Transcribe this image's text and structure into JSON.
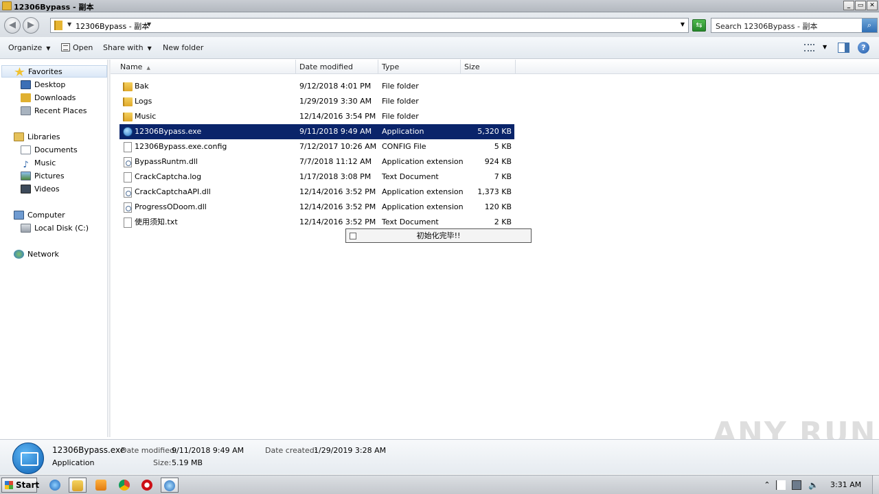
{
  "window": {
    "title": "12306Bypass - 副本",
    "buttons": [
      "_",
      "▭",
      "✕"
    ]
  },
  "address": {
    "path": "12306Bypass - 副本",
    "search_placeholder": "Search 12306Bypass - 副本"
  },
  "toolbar": {
    "organize": "Organize",
    "open": "Open",
    "share_with": "Share with",
    "new_folder": "New folder"
  },
  "nav": {
    "favorites": "Favorites",
    "desktop": "Desktop",
    "downloads": "Downloads",
    "recent_places": "Recent Places",
    "libraries": "Libraries",
    "documents": "Documents",
    "music": "Music",
    "pictures": "Pictures",
    "videos": "Videos",
    "computer": "Computer",
    "local_disk": "Local Disk (C:)",
    "network": "Network"
  },
  "columns": {
    "name": "Name",
    "date_modified": "Date modified",
    "type": "Type",
    "size": "Size"
  },
  "files": [
    {
      "name": "Bak",
      "date": "9/12/2018 4:01 PM",
      "type": "File folder",
      "size": "",
      "icon": "folder-icon"
    },
    {
      "name": "Logs",
      "date": "1/29/2019 3:30 AM",
      "type": "File folder",
      "size": "",
      "icon": "folder-icon"
    },
    {
      "name": "Music",
      "date": "12/14/2016 3:54 PM",
      "type": "File folder",
      "size": "",
      "icon": "folder-icon"
    },
    {
      "name": "12306Bypass.exe",
      "date": "9/11/2018 9:49 AM",
      "type": "Application",
      "size": "5,320 KB",
      "icon": "app-icon",
      "selected": true
    },
    {
      "name": "12306Bypass.exe.config",
      "date": "7/12/2017 10:26 AM",
      "type": "CONFIG File",
      "size": "5 KB",
      "icon": "file-icon"
    },
    {
      "name": "BypassRuntm.dll",
      "date": "7/7/2018 11:12 AM",
      "type": "Application extension",
      "size": "924 KB",
      "icon": "dll-icon"
    },
    {
      "name": "CrackCaptcha.log",
      "date": "1/17/2018 3:08 PM",
      "type": "Text Document",
      "size": "7 KB",
      "icon": "file-icon"
    },
    {
      "name": "CrackCaptchaAPI.dll",
      "date": "12/14/2016 3:52 PM",
      "type": "Application extension",
      "size": "1,373 KB",
      "icon": "dll-icon"
    },
    {
      "name": "ProgressODoom.dll",
      "date": "12/14/2016 3:52 PM",
      "type": "Application extension",
      "size": "120 KB",
      "icon": "dll-icon"
    },
    {
      "name": "使用须知.txt",
      "date": "12/14/2016 3:52 PM",
      "type": "Text Document",
      "size": "2 KB",
      "icon": "file-icon"
    }
  ],
  "popup": {
    "text": "初始化完毕!!"
  },
  "details": {
    "name": "12306Bypass.exe",
    "type": "Application",
    "date_modified_label": "Date modified:",
    "date_modified": "9/11/2018 9:49 AM",
    "size_label": "Size:",
    "size": "5.19 MB",
    "date_created_label": "Date created:",
    "date_created": "1/29/2019 3:28 AM"
  },
  "watermark": "ANY RUN",
  "taskbar": {
    "start": "Start",
    "clock": "3:31 AM"
  }
}
